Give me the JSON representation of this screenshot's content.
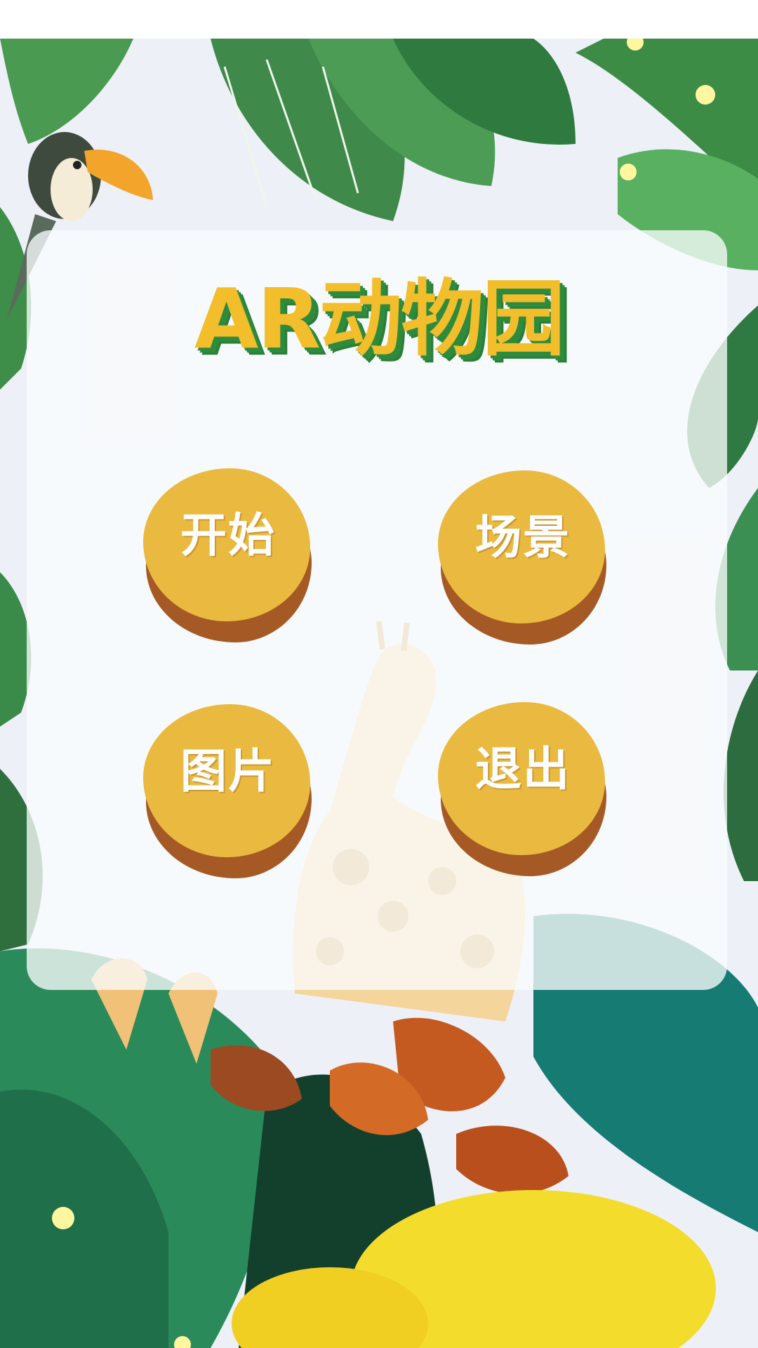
{
  "title": "AR动物园",
  "menu": {
    "start": "开始",
    "scene": "场景",
    "picture": "图片",
    "exit": "退出"
  },
  "colors": {
    "title_fill": "#f2be2c",
    "title_shadow": "#2e8b3e",
    "button_face": "#e9ba3f",
    "button_rim": "#a55a25",
    "button_text": "#ffffff"
  }
}
